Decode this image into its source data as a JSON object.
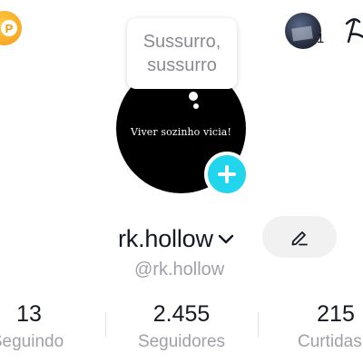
{
  "header": {
    "coin_icon": "coin-icon",
    "coin_symbol": "P",
    "story_count": "1",
    "right_icon": "edge-icon"
  },
  "bubble": {
    "line1": "Sussurro,",
    "line2": "sussurro"
  },
  "profile": {
    "avatar_text": "Viver sozinho vicia!",
    "username": "rk.hollow",
    "handle": "@rk.hollow"
  },
  "stats": [
    {
      "value": "13",
      "label": "Seguindo"
    },
    {
      "value": "2.455",
      "label": "Seguidores"
    },
    {
      "value": "215",
      "label": "Curtidas"
    }
  ],
  "colors": {
    "accent": "#20d5ec",
    "coin": "#f9a825",
    "text": "#161823",
    "muted": "#a0a1a7"
  }
}
